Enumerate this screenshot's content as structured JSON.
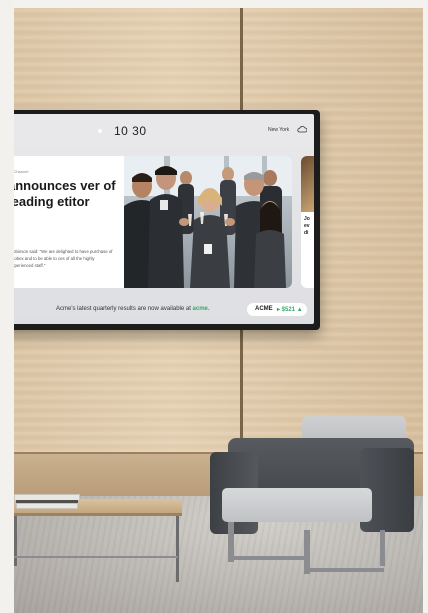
{
  "tv": {
    "time": "10 30",
    "location": "New York",
    "weather_icon": "cloud-icon",
    "article": {
      "back_label": "< Channel",
      "headline": "announces ver of leading etitor",
      "body": "Robinson said: \"We are delighted to have purchase of Globex and to be able to ces of all the highly experienced staff.\""
    },
    "side_card_letters": "Jo ev di",
    "ticker": {
      "message_prefix": "Acme's latest quarterly results are now available at",
      "message_brand": "acme.",
      "stock_symbol": "ACME",
      "stock_value": "▸ $521 ▲"
    }
  },
  "colors": {
    "accent_green": "#3aa868",
    "wall_wood": "#dcc6a6",
    "chair_fabric": "#4a4d51"
  }
}
